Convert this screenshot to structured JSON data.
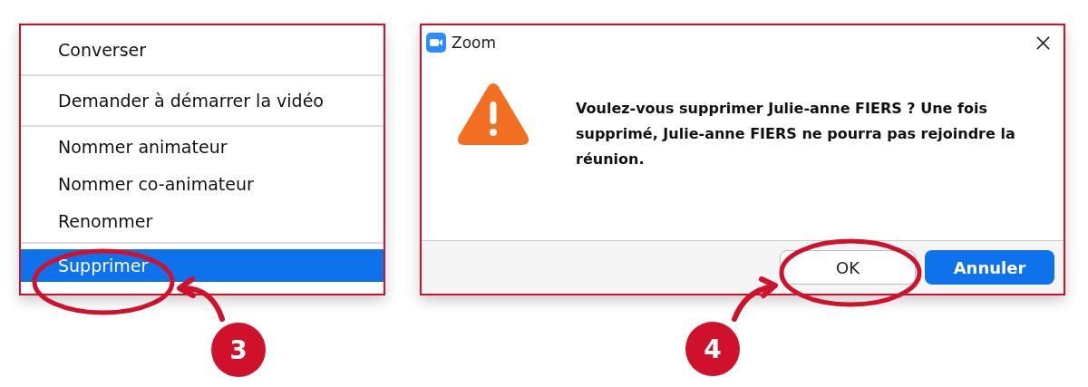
{
  "context_menu": {
    "groups": [
      {
        "items": [
          {
            "label": "Converser",
            "selected": false
          }
        ]
      },
      {
        "items": [
          {
            "label": "Demander à démarrer la vidéo",
            "selected": false
          }
        ]
      },
      {
        "items": [
          {
            "label": "Nommer animateur",
            "selected": false
          },
          {
            "label": "Nommer co-animateur",
            "selected": false
          },
          {
            "label": "Renommer",
            "selected": false
          }
        ]
      },
      {
        "items": [
          {
            "label": "Supprimer",
            "selected": true
          }
        ]
      }
    ]
  },
  "dialog": {
    "title": "Zoom",
    "message": "Voulez-vous supprimer Julie-anne FIERS ? Une fois supprimé, Julie-anne FIERS ne pourra pas rejoindre la réunion.",
    "buttons": [
      {
        "label": "OK",
        "kind": "secondary"
      },
      {
        "label": "Annuler",
        "kind": "primary"
      }
    ]
  },
  "annotations": [
    {
      "step": "3"
    },
    {
      "step": "4"
    }
  ]
}
